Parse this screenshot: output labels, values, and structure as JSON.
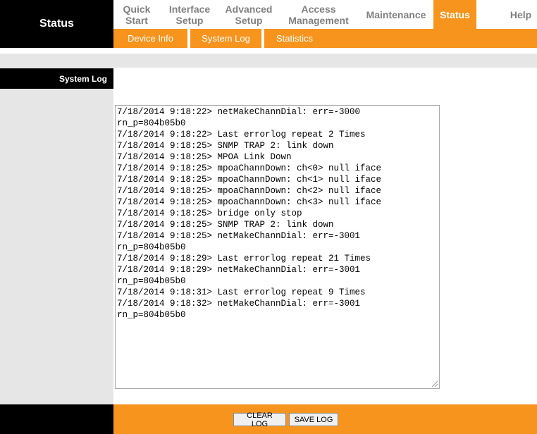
{
  "header": {
    "title": "Status"
  },
  "nav": [
    {
      "line1": "Quick",
      "line2": "Start"
    },
    {
      "line1": "Interface",
      "line2": "Setup"
    },
    {
      "line1": "Advanced",
      "line2": "Setup"
    },
    {
      "line1": "Access",
      "line2": "Management"
    },
    {
      "line1": "Maintenance",
      "line2": ""
    },
    {
      "line1": "Status",
      "line2": ""
    },
    {
      "line1": "Help",
      "line2": ""
    }
  ],
  "subnav": [
    "Device Info",
    "System Log",
    "Statistics"
  ],
  "section": {
    "label": "System Log"
  },
  "log": {
    "text": "7/18/2014 9:18:22> netMakeChannDial: err=-3000\nrn_p=804b05b0\n7/18/2014 9:18:22> Last errorlog repeat 2 Times\n7/18/2014 9:18:25> SNMP TRAP 2: link down\n7/18/2014 9:18:25> MPOA Link Down\n7/18/2014 9:18:25> mpoaChannDown: ch<0> null iface\n7/18/2014 9:18:25> mpoaChannDown: ch<1> null iface\n7/18/2014 9:18:25> mpoaChannDown: ch<2> null iface\n7/18/2014 9:18:25> mpoaChannDown: ch<3> null iface\n7/18/2014 9:18:25> bridge only stop\n7/18/2014 9:18:25> SNMP TRAP 2: link down\n7/18/2014 9:18:25> netMakeChannDial: err=-3001\nrn_p=804b05b0\n7/18/2014 9:18:29> Last errorlog repeat 21 Times\n7/18/2014 9:18:29> netMakeChannDial: err=-3001\nrn_p=804b05b0\n7/18/2014 9:18:31> Last errorlog repeat 9 Times\n7/18/2014 9:18:32> netMakeChannDial: err=-3001\nrn_p=804b05b0"
  },
  "buttons": {
    "clear": "CLEAR LOG",
    "save": "SAVE LOG"
  },
  "colors": {
    "accent": "#f7941d",
    "dark": "#000000",
    "panel": "#e6e6e6",
    "nav_text": "#808080"
  }
}
